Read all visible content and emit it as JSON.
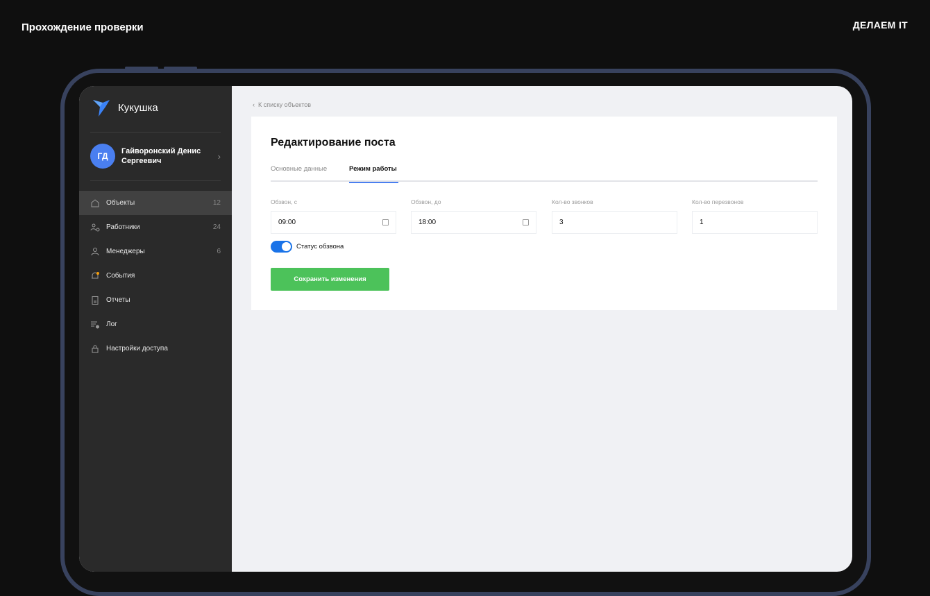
{
  "slide": {
    "title": "Прохождение проверки",
    "brand": "ДЕЛАЕМ IT"
  },
  "sidebar": {
    "app_name": "Кукушка",
    "user": {
      "initials": "ГД",
      "name": "Гайворонский Денис Сергеевич"
    },
    "items": [
      {
        "label": "Объекты",
        "count": "12",
        "icon": "home-icon"
      },
      {
        "label": "Работники",
        "count": "24",
        "icon": "workers-icon"
      },
      {
        "label": "Менеджеры",
        "count": "6",
        "icon": "user-icon"
      },
      {
        "label": "События",
        "icon": "bell-icon"
      },
      {
        "label": "Отчеты",
        "icon": "document-icon"
      },
      {
        "label": "Лог",
        "icon": "log-icon"
      },
      {
        "label": "Настройки доступа",
        "icon": "lock-icon"
      }
    ]
  },
  "main": {
    "back": "К списку объектов",
    "title": "Редактирование поста",
    "tabs": [
      {
        "label": "Основные данные"
      },
      {
        "label": "Режим работы"
      }
    ],
    "fields": [
      {
        "label": "Обзвон, с",
        "value": "09:00"
      },
      {
        "label": "Обзвон, до",
        "value": "18:00"
      },
      {
        "label": "Кол-во звонков",
        "value": "3"
      },
      {
        "label": "Кол-во перезвонов",
        "value": "1"
      }
    ],
    "toggle_label": "Статус обзвона",
    "toggle_on": true,
    "save": "Сохранить изменения"
  },
  "colors": {
    "accent": "#4a7ff0",
    "save": "#4cc25a",
    "sidebar": "#2a2a2a"
  }
}
